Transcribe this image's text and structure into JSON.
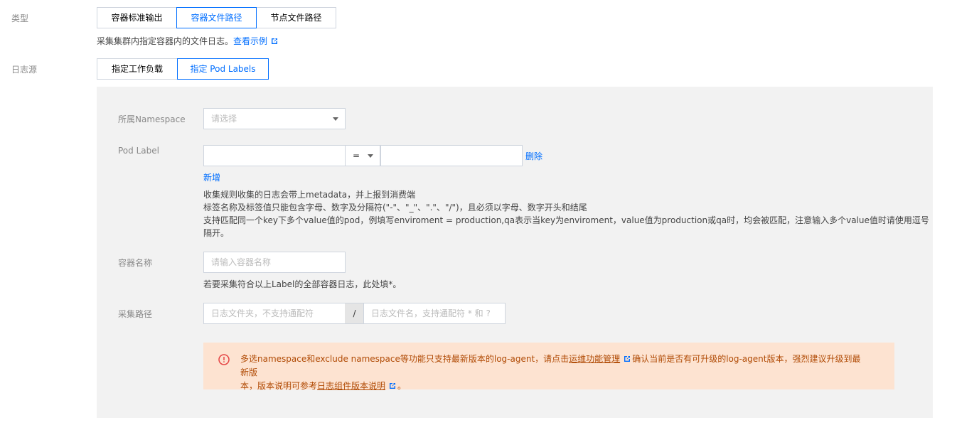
{
  "type_field": {
    "label": "类型",
    "options": [
      "容器标准输出",
      "容器文件路径",
      "节点文件路径"
    ],
    "selected": "容器文件路径",
    "hint": "采集集群内指定容器内的文件日志。",
    "hint_link": "查看示例"
  },
  "log_source_field": {
    "label": "日志源",
    "options": [
      "指定工作负载",
      "指定 Pod Labels"
    ],
    "selected": "指定 Pod Labels"
  },
  "panel": {
    "namespace": {
      "label": "所属Namespace",
      "placeholder": "请选择"
    },
    "pod_label": {
      "label": "Pod Label",
      "key_value": "",
      "operator": "=",
      "value_value": "",
      "delete_label": "删除",
      "add_label": "新增",
      "desc": [
        "收集规则收集的日志会带上metadata，并上报到消费端",
        "标签名称及标签值只能包含字母、数字及分隔符(\"-\"、\"_\"、\".\"、\"/\")，且必须以字母、数字开头和结尾",
        "支持匹配同一个key下多个value值的pod，例填写enviroment = production,qa表示当key为enviroment，value值为production或qa时，均会被匹配，注意输入多个value值时请使用逗号",
        "隔开。"
      ]
    },
    "container_name": {
      "label": "容器名称",
      "placeholder": "请输入容器名称",
      "hint": "若要采集符合以上Label的全部容器日志，此处填*。"
    },
    "collect_path": {
      "label": "采集路径",
      "dir_placeholder": "日志文件夹，不支持通配符",
      "separator": "/",
      "file_placeholder": "日志文件名，支持通配符 * 和 ?"
    },
    "warning": {
      "text_1": "多选namespace和exclude namespace等功能只支持最新版本的log-agent，请点击",
      "link_1": "运维功能管理",
      "text_2": "确认当前是否有可升级的log-agent版本，强烈建议升级到最新版",
      "text_3": "本，版本说明可参考",
      "link_2": "日志组件版本说明",
      "text_4": "。"
    }
  },
  "colors": {
    "accent": "#006eff",
    "panel_bg": "#f2f2f2",
    "warning_bg": "#fde3d1",
    "warning_text": "#b04a04"
  }
}
